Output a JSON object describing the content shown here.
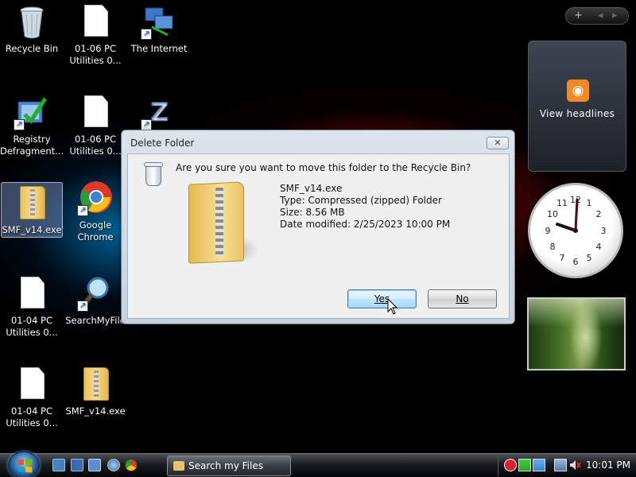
{
  "desktop": {
    "icons": [
      {
        "label": "Recycle Bin"
      },
      {
        "label": "01-06 PC Utilities 0..."
      },
      {
        "label": "The Internet"
      },
      {
        "label": "Registry Defragment..."
      },
      {
        "label": "01-06 PC Utilities 0..."
      },
      {
        "label": "SMF_v14.exe"
      },
      {
        "label": "Google Chrome"
      },
      {
        "label": "01-04 PC Utilities 0..."
      },
      {
        "label": "SearchMyFile"
      },
      {
        "label": "01-04 PC Utilities 0..."
      },
      {
        "label": "SMF_v14.exe"
      }
    ]
  },
  "gadgets": {
    "bar_add": "+",
    "bar_prev": "◂",
    "bar_next": "▸",
    "news_label": "View headlines",
    "clock_time": "10:01"
  },
  "dialog": {
    "title": "Delete Folder",
    "close_glyph": "✕",
    "question": "Are you sure you want to move this folder to the Recycle Bin?",
    "file_name": "SMF_v14.exe",
    "file_type": "Type: Compressed (zipped) Folder",
    "file_size": "Size: 8.56 MB",
    "file_modified": "Date modified: 2/25/2023 10:00 PM",
    "yes_label": "Yes",
    "no_label": "No"
  },
  "taskbar": {
    "task_label": "Search my Files dow...",
    "time": "10:01 PM"
  },
  "colors": {
    "dialog_border": "#6a7a8c",
    "button_focus": "#3c7fb1",
    "rss_orange": "#f08a24"
  }
}
